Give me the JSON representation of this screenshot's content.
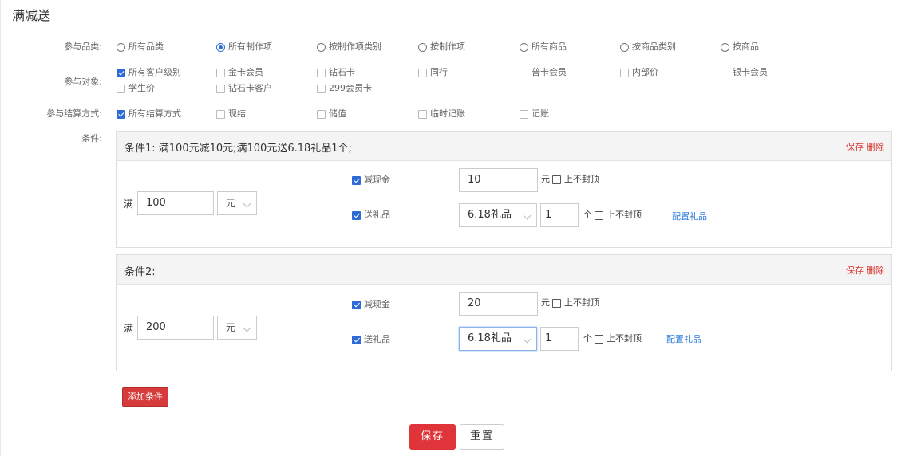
{
  "title": "满减送",
  "category": {
    "label": "参与品类:",
    "options": [
      "所有品类",
      "所有制作项",
      "按制作项类别",
      "按制作项",
      "所有商品",
      "按商品类别",
      "按商品"
    ],
    "selected": 1
  },
  "target": {
    "label": "参与对象:",
    "row1": [
      "所有客户级别",
      "金卡会员",
      "钻石卡",
      "同行",
      "普卡会员",
      "内部价",
      "银卡会员"
    ],
    "row2": [
      "学生价",
      "钻石卡客户",
      "299会员卡"
    ],
    "checked": "所有客户级别"
  },
  "settlement": {
    "label": "参与结算方式:",
    "options": [
      "所有结算方式",
      "现结",
      "储值",
      "临时记账",
      "记账"
    ],
    "checked": "所有结算方式"
  },
  "conditions_label": "条件:",
  "conditions": [
    {
      "title": "条件1: 满100元减10元;满100元送6.18礼品1个;",
      "save": "保存",
      "delete": "删除",
      "threshold_prefix": "满",
      "threshold": "100",
      "unit": "元",
      "cash_label": "减现金",
      "cash_value": "10",
      "cash_unit": "元",
      "no_cap": "上不封顶",
      "gift_label": "送礼品",
      "gift_select": "6.18礼品",
      "gift_qty": "1",
      "gift_unit": "个",
      "gift_config": "配置礼品"
    },
    {
      "title": "条件2:",
      "save": "保存",
      "delete": "删除",
      "threshold_prefix": "满",
      "threshold": "200",
      "unit": "元",
      "cash_label": "减现金",
      "cash_value": "20",
      "cash_unit": "元",
      "no_cap": "上不封顶",
      "gift_label": "送礼品",
      "gift_select": "6.18礼品",
      "gift_qty": "1",
      "gift_unit": "个",
      "gift_config": "配置礼品"
    }
  ],
  "add_condition": "添加条件",
  "save_button": "保存",
  "reset_button": "重置"
}
